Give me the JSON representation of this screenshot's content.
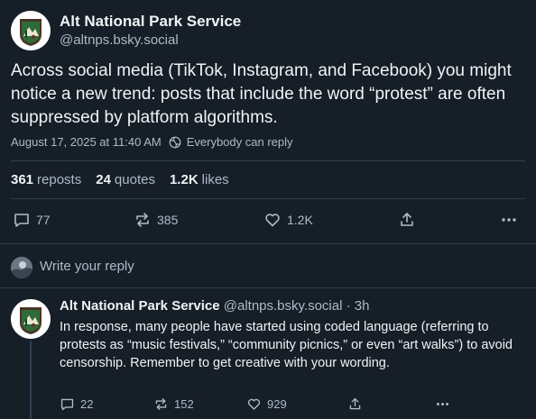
{
  "post": {
    "author_name": "Alt National Park Service",
    "author_handle": "@altnps.bsky.social",
    "text": "Across social media (TikTok, Instagram, and Facebook) you might notice a new trend: posts that include the word “protest” are often suppressed by platform algorithms.",
    "timestamp": "August 17, 2025 at 11:40 AM",
    "reply_setting": "Everybody can reply",
    "stats": {
      "reposts_count": "361",
      "reposts_label": "reposts",
      "quotes_count": "24",
      "quotes_label": "quotes",
      "likes_count": "1.2K",
      "likes_label": "likes"
    },
    "actions": {
      "replies": "77",
      "reposts": "385",
      "likes": "1.2K"
    }
  },
  "composer": {
    "placeholder": "Write your reply"
  },
  "reply": {
    "author_name": "Alt National Park Service",
    "author_handle": "@altnps.bsky.social",
    "separator": "·",
    "time": "3h",
    "text": "In response, many people have started using coded language (referring to protests as “music festivals,” “community picnics,” or even “art walks”) to avoid censorship. Remember to get creative with your wording.",
    "actions": {
      "replies": "22",
      "reposts": "152",
      "likes": "929"
    }
  },
  "colors": {
    "background": "#161e27",
    "text_primary": "#f1f3f5",
    "text_secondary": "#aebbc9",
    "divider": "#2e4052"
  },
  "icons": [
    "nps-logo-avatar",
    "globe-icon",
    "comment-icon",
    "repost-icon",
    "heart-icon",
    "share-icon",
    "more-icon",
    "user-avatar"
  ]
}
